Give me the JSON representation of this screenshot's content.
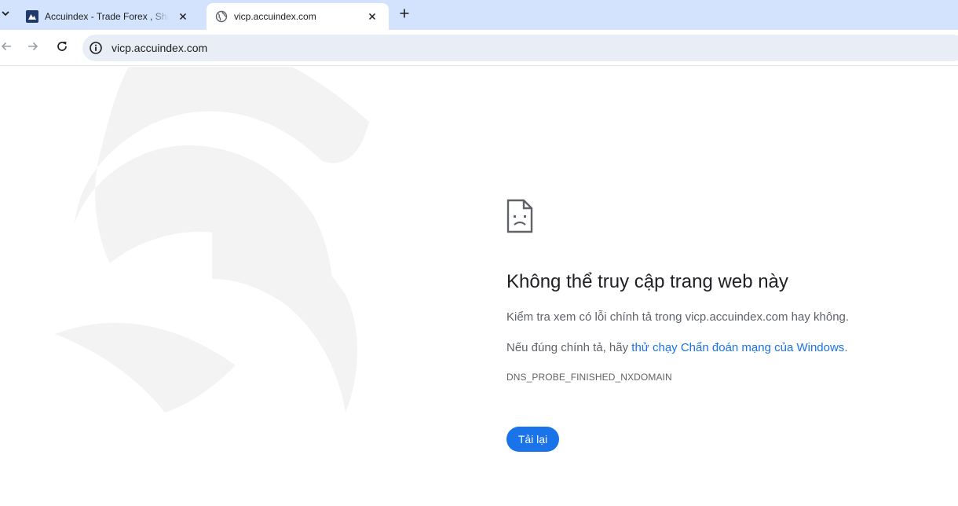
{
  "browser": {
    "tabs": [
      {
        "title": "Accuindex - Trade Forex , Shares",
        "favicon": "accuindex-logo-icon",
        "active": false
      },
      {
        "title": "vicp.accuindex.com",
        "favicon": "globe-icon",
        "active": true
      }
    ],
    "new_tab_icon": "plus-icon",
    "omnibox": {
      "url": "vicp.accuindex.com",
      "icon": "info-icon"
    }
  },
  "error_page": {
    "icon": "sad-page-icon",
    "title": "Không thể truy cập trang web này",
    "line1": "Kiểm tra xem có lỗi chính tả trong vicp.accuindex.com hay không.",
    "line2_prefix": "Nếu đúng chính tả, hãy ",
    "line2_link": "thử chạy Chẩn đoán mạng của Windows",
    "line2_suffix": ".",
    "error_code": "DNS_PROBE_FINISHED_NXDOMAIN",
    "reload_label": "Tải lại"
  },
  "colors": {
    "tabstrip_bg": "#d3e3fd",
    "omnibox_bg": "#e9eef6",
    "accent": "#1a73e8",
    "title_text": "#202124",
    "body_text": "#5f6368"
  }
}
